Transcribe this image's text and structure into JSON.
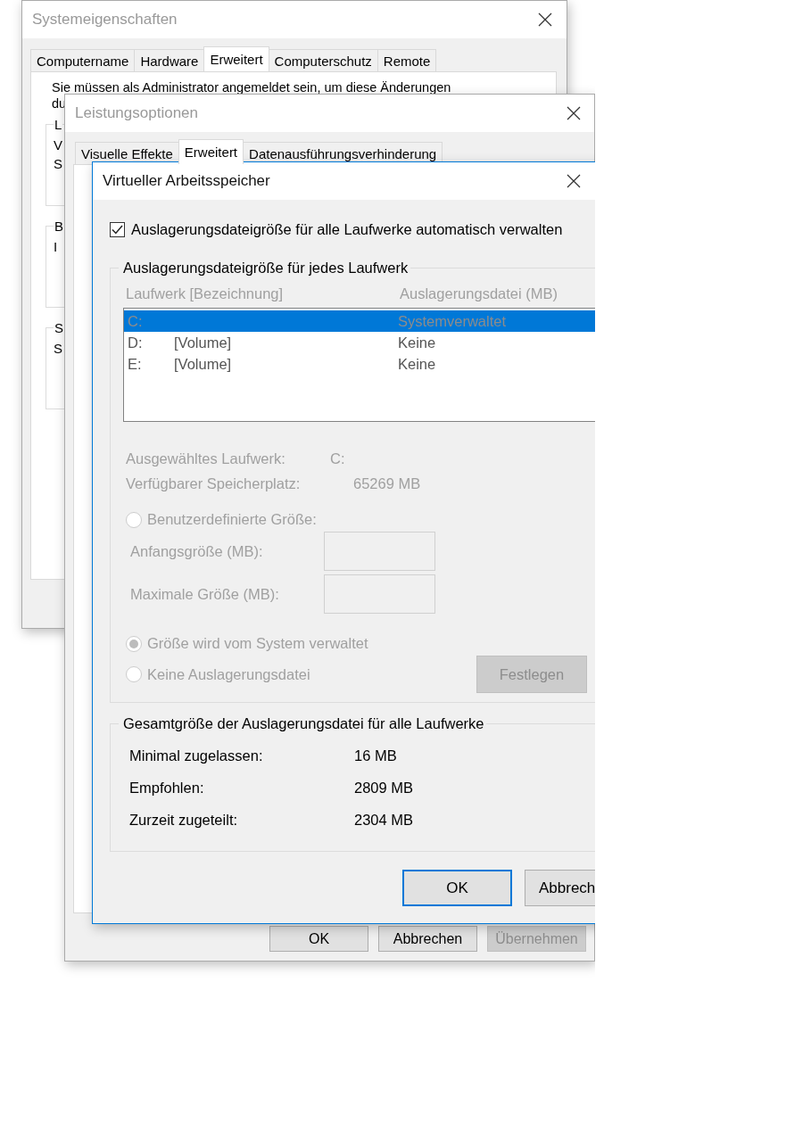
{
  "system_properties": {
    "title": "Systemeigenschaften",
    "tabs": [
      {
        "label": "Computername",
        "selected": false
      },
      {
        "label": "Hardware",
        "selected": false
      },
      {
        "label": "Erweitert",
        "selected": true
      },
      {
        "label": "Computerschutz",
        "selected": false
      },
      {
        "label": "Remote",
        "selected": false
      }
    ],
    "notice": "Sie müssen als Administrator angemeldet sein, um diese Änderungen",
    "notice_line_2": "du",
    "groups": [
      {
        "title": "L",
        "lines": [
          "V",
          "S"
        ]
      },
      {
        "title": "B",
        "lines": [
          "I"
        ]
      },
      {
        "title": "S",
        "lines": [
          "S"
        ]
      }
    ]
  },
  "performance_options": {
    "title": "Leistungsoptionen",
    "tabs": [
      {
        "label": "Visuelle Effekte",
        "selected": false
      },
      {
        "label": "Erweitert",
        "selected": true
      },
      {
        "label": "Datenausführungsverhinderung",
        "selected": false
      }
    ],
    "buttons": [
      {
        "label": "OK",
        "disabled": false
      },
      {
        "label": "Abbrechen",
        "disabled": false
      },
      {
        "label": "Übernehmen",
        "disabled": true
      }
    ]
  },
  "virtual_memory": {
    "title": "Virtueller Arbeitsspeicher",
    "auto_manage": {
      "label": "Auslagerungsdateigröße für alle Laufwerke automatisch verwalten",
      "checked": true
    },
    "per_drive": {
      "title": "Auslagerungsdateigröße für jedes Laufwerk",
      "disabled": true,
      "columns": [
        "Laufwerk [Bezeichnung]",
        "Auslagerungsdatei (MB)"
      ],
      "drives": [
        {
          "drive": "C:",
          "size": "Systemverwaltet",
          "selected": true
        },
        {
          "drive": "D:",
          "volume": "[Volume]",
          "size": "Keine",
          "selected": false
        },
        {
          "drive": "E:",
          "volume": "[Volume]",
          "size": "Keine",
          "selected": false
        }
      ],
      "selected_drive": {
        "label": "Ausgewähltes Laufwerk:",
        "value": "C:"
      },
      "free_space": {
        "label": "Verfügbarer Speicherplatz:",
        "value": "65269 MB"
      },
      "options": [
        {
          "label": "Benutzerdefinierte Größe:",
          "selected": false
        },
        {
          "label": "Größe wird vom System verwaltet",
          "selected": true
        },
        {
          "label": "Keine Auslagerungsdatei",
          "selected": false
        }
      ],
      "fields": [
        {
          "label": "Anfangsgröße (MB):"
        },
        {
          "label": "Maximale Größe (MB):"
        }
      ],
      "set_button": {
        "label": "Festlegen",
        "disabled": true
      }
    },
    "totals": {
      "title": "Gesamtgröße der Auslagerungsdatei für alle Laufwerke",
      "rows": [
        {
          "label": "Minimal zugelassen:",
          "value": "16 MB"
        },
        {
          "label": "Empfohlen:",
          "value": "2809 MB"
        },
        {
          "label": "Zurzeit zugeteilt:",
          "value": "2304 MB"
        }
      ]
    },
    "buttons": [
      {
        "label": "OK",
        "default": true
      },
      {
        "label": "Abbrech",
        "default": false
      }
    ]
  }
}
